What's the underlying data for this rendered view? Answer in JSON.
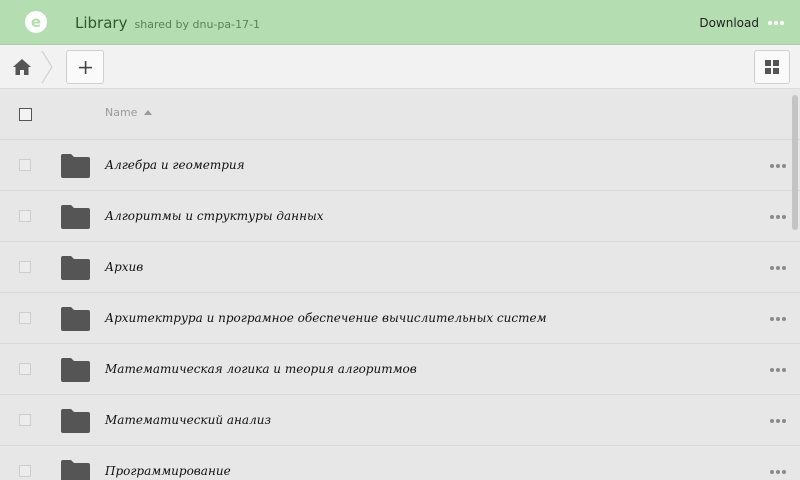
{
  "header": {
    "logo_letter": "e",
    "title": "Library",
    "shared_by": "shared by dnu-pa-17-1",
    "download_label": "Download",
    "more_icon": "ellipsis-icon"
  },
  "toolbar": {
    "home_icon": "home-icon",
    "add_icon": "plus-icon",
    "view_icon": "grid-view-icon"
  },
  "list": {
    "column_name": "Name",
    "sort": "ascending",
    "rows": [
      {
        "name": "Алгебра и геометрия",
        "type": "folder"
      },
      {
        "name": "Алгоритмы и структуры данных",
        "type": "folder"
      },
      {
        "name": "Архив",
        "type": "folder"
      },
      {
        "name": "Архитектрура и програмное обеспечение вычислительных систем",
        "type": "folder"
      },
      {
        "name": "Математическая логика и теория алгоритмов",
        "type": "folder"
      },
      {
        "name": "Математический анализ",
        "type": "folder"
      },
      {
        "name": "Программирование",
        "type": "folder"
      }
    ]
  },
  "colors": {
    "header_bg": "#b4ddb2",
    "title": "#30572d",
    "folder": "#555555"
  }
}
